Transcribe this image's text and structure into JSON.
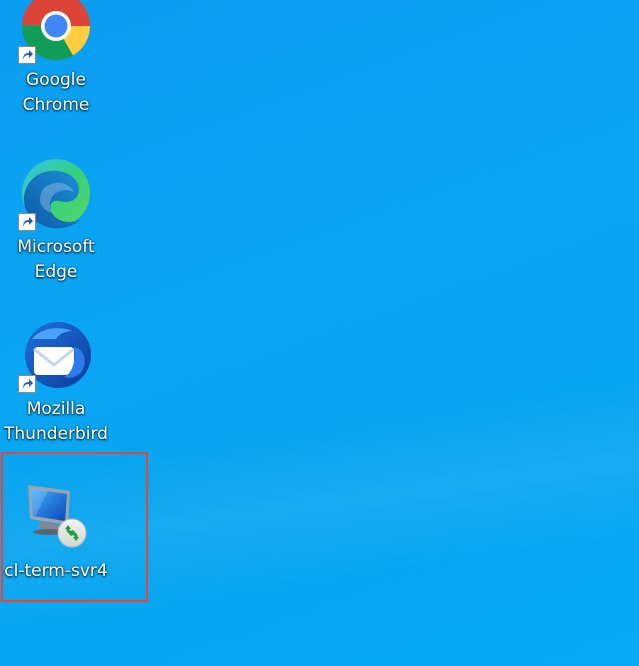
{
  "desktop": {
    "background_color": "#0aa6f3",
    "selection_color": "#e0463a",
    "icons": [
      {
        "label": "Google\nChrome",
        "icon": "chrome-icon",
        "shortcut": true
      },
      {
        "label": "Microsoft\nEdge",
        "icon": "edge-icon",
        "shortcut": true
      },
      {
        "label": "Mozilla\nThunderbird",
        "icon": "thunderbird-icon",
        "shortcut": true
      },
      {
        "label": "cl-term-svr4",
        "icon": "remote-desktop-icon",
        "shortcut": false,
        "selected": true
      }
    ]
  }
}
